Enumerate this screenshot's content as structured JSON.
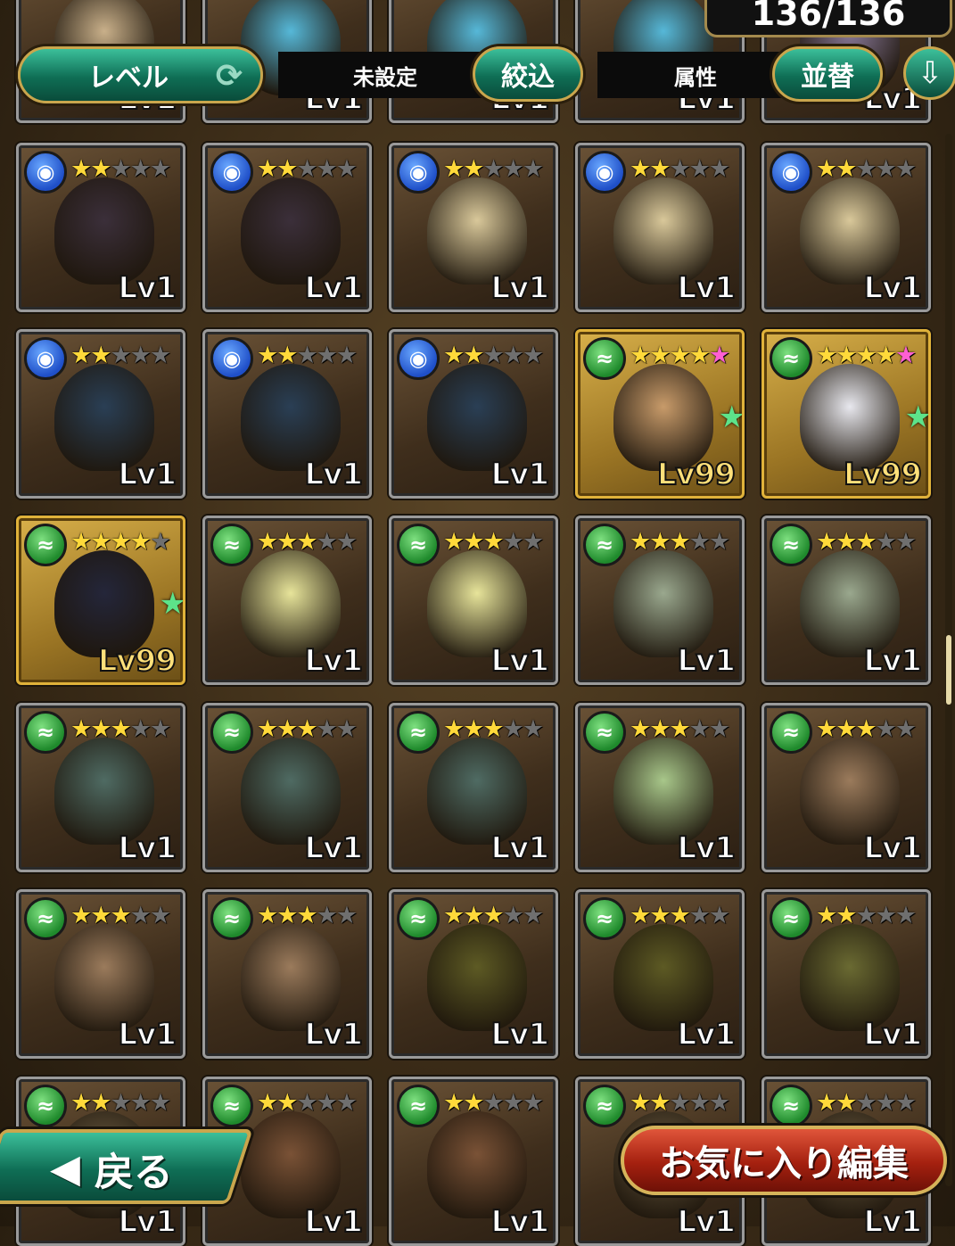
{
  "header": {
    "counter": "136/136",
    "level_button": "レベル",
    "filter_value": "未設定",
    "filter_button": "絞込",
    "sort_value": "属性",
    "sort_button": "並替"
  },
  "footer": {
    "back_label": "戻る",
    "favorite_edit_label": "お気に入り編集"
  },
  "elements": {
    "water": {
      "icon": "water-element-icon",
      "color": "#2f6be0"
    },
    "wind": {
      "icon": "wind-element-icon",
      "color": "#29a83a"
    }
  },
  "units": [
    {
      "element": "water",
      "stars": 2,
      "level": "Lv1",
      "tint": "#3b2f3a"
    },
    {
      "element": "water",
      "stars": 2,
      "level": "Lv1",
      "tint": "#3b2f3a"
    },
    {
      "element": "water",
      "stars": 2,
      "level": "Lv1",
      "tint": "#d9c89a"
    },
    {
      "element": "water",
      "stars": 2,
      "level": "Lv1",
      "tint": "#d9c89a"
    },
    {
      "element": "water",
      "stars": 2,
      "level": "Lv1",
      "tint": "#d9c89a"
    },
    {
      "element": "water",
      "stars": 2,
      "level": "Lv1",
      "tint": "#2a3f55"
    },
    {
      "element": "water",
      "stars": 2,
      "level": "Lv1",
      "tint": "#2a3f55"
    },
    {
      "element": "water",
      "stars": 2,
      "level": "Lv1",
      "tint": "#2a3f55"
    },
    {
      "element": "wind",
      "stars": 5,
      "level": "Lv99",
      "rare": true,
      "favorite": true,
      "tint": "#c89b6a"
    },
    {
      "element": "wind",
      "stars": 5,
      "level": "Lv99",
      "rare": true,
      "favorite": true,
      "tint": "#e8e8ee"
    },
    {
      "element": "wind",
      "stars": 4,
      "level": "Lv99",
      "rare": true,
      "favorite": true,
      "tint": "#24263a"
    },
    {
      "element": "wind",
      "stars": 3,
      "level": "Lv1",
      "tint": "#e7e49a"
    },
    {
      "element": "wind",
      "stars": 3,
      "level": "Lv1",
      "tint": "#e7e49a"
    },
    {
      "element": "wind",
      "stars": 3,
      "level": "Lv1",
      "tint": "#9aa88e"
    },
    {
      "element": "wind",
      "stars": 3,
      "level": "Lv1",
      "tint": "#9aa88e"
    },
    {
      "element": "wind",
      "stars": 3,
      "level": "Lv1",
      "tint": "#4f6b63"
    },
    {
      "element": "wind",
      "stars": 3,
      "level": "Lv1",
      "tint": "#4f6b63"
    },
    {
      "element": "wind",
      "stars": 3,
      "level": "Lv1",
      "tint": "#4f6b63"
    },
    {
      "element": "wind",
      "stars": 3,
      "level": "Lv1",
      "tint": "#a8c78a"
    },
    {
      "element": "wind",
      "stars": 3,
      "level": "Lv1",
      "tint": "#9b7b5c"
    },
    {
      "element": "wind",
      "stars": 3,
      "level": "Lv1",
      "tint": "#9b7b5c"
    },
    {
      "element": "wind",
      "stars": 3,
      "level": "Lv1",
      "tint": "#9b7b5c"
    },
    {
      "element": "wind",
      "stars": 3,
      "level": "Lv1",
      "tint": "#5d5a24"
    },
    {
      "element": "wind",
      "stars": 3,
      "level": "Lv1",
      "tint": "#5d5a24"
    },
    {
      "element": "wind",
      "stars": 2,
      "level": "Lv1",
      "tint": "#6a6a32"
    },
    {
      "element": "wind",
      "stars": 2,
      "level": "Lv1",
      "tint": "#6a5a40"
    },
    {
      "element": "wind",
      "stars": 2,
      "level": "Lv1",
      "tint": "#7a5236"
    },
    {
      "element": "wind",
      "stars": 2,
      "level": "Lv1",
      "tint": "#7a5236"
    },
    {
      "element": "wind",
      "stars": 2,
      "level": "Lv1",
      "tint": "#6a5a40"
    },
    {
      "element": "wind",
      "stars": 2,
      "level": "Lv1",
      "tint": "#6a5a40"
    }
  ],
  "top_partial_units": [
    {
      "level": "Lv1",
      "tint": "#c9b08a"
    },
    {
      "level": "Lv1",
      "tint": "#56b8d8"
    },
    {
      "level": "Lv1",
      "tint": "#56b8d8"
    },
    {
      "level": "Lv1",
      "tint": "#56b8d8"
    },
    {
      "level": "Lv1",
      "tint": "#8a7a9a"
    }
  ]
}
